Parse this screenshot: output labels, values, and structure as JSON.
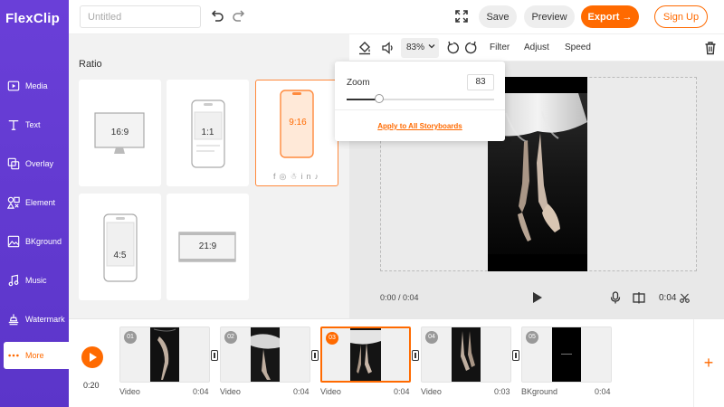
{
  "app": {
    "logo": "FlexClip"
  },
  "sidebar": {
    "items": [
      {
        "label": "Media",
        "icon": "media-icon"
      },
      {
        "label": "Text",
        "icon": "text-icon"
      },
      {
        "label": "Overlay",
        "icon": "overlay-icon"
      },
      {
        "label": "Element",
        "icon": "element-icon"
      },
      {
        "label": "BKground",
        "icon": "background-icon"
      },
      {
        "label": "Music",
        "icon": "music-icon"
      },
      {
        "label": "Watermark",
        "icon": "watermark-icon"
      },
      {
        "label": "More",
        "icon": "more-icon",
        "active": true
      }
    ]
  },
  "header": {
    "title_placeholder": "Untitled",
    "save_label": "Save",
    "preview_label": "Preview",
    "export_label": "Export",
    "signup_label": "Sign Up"
  },
  "ratio": {
    "title": "Ratio",
    "options": [
      "16:9",
      "1:1",
      "9:16",
      "4:5",
      "21:9"
    ],
    "selected": "9:16"
  },
  "toolbar": {
    "zoom_value": "83%",
    "filter_label": "Filter",
    "adjust_label": "Adjust",
    "speed_label": "Speed"
  },
  "zoom_popup": {
    "label": "Zoom",
    "value": "83",
    "level": 0.83,
    "apply_label": "Apply to All Storyboards"
  },
  "player": {
    "time_current": "0:00 / 0:04",
    "duration": "0:04"
  },
  "timeline": {
    "total_time": "0:20",
    "clips": [
      {
        "num": "01",
        "name": "Video",
        "duration": "0:04"
      },
      {
        "num": "02",
        "name": "Video",
        "duration": "0:04"
      },
      {
        "num": "03",
        "name": "Video",
        "duration": "0:04",
        "active": true
      },
      {
        "num": "04",
        "name": "Video",
        "duration": "0:03"
      },
      {
        "num": "05",
        "name": "BKground",
        "duration": "0:04"
      }
    ]
  },
  "colors": {
    "accent": "#ff6a00",
    "sidebar": "#5b35c9"
  }
}
